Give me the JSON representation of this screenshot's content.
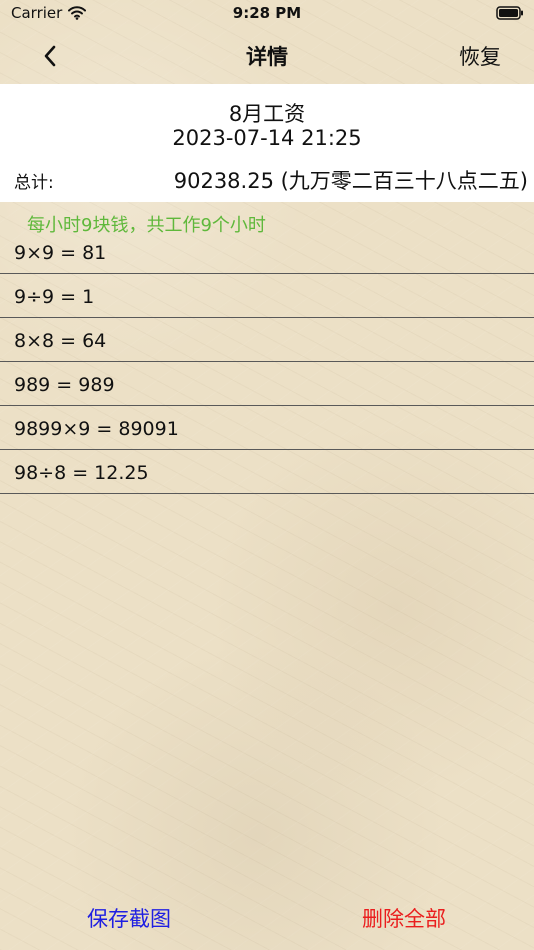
{
  "status_bar": {
    "carrier": "Carrier",
    "time": "9:28 PM"
  },
  "nav": {
    "title": "详情",
    "restore_label": "恢复"
  },
  "record": {
    "title": "8月工资",
    "date": "2023-07-14 21:25",
    "total_label": "总计:",
    "total_value": "90238.25 (九万零二百三十八点二五)"
  },
  "note": "每小时9块钱，共工作9个小时",
  "calculations": [
    "9×9 = 81",
    "9÷9 = 1",
    "8×8 = 64",
    "989 = 989",
    "9899×9 = 89091",
    "98÷8 = 12.25"
  ],
  "actions": {
    "save_screenshot": "保存截图",
    "delete_all": "删除全部"
  },
  "colors": {
    "background": "#ece0c6",
    "note_green": "#5fb83b",
    "save_blue": "#1f1fe2",
    "delete_red": "#ea1e1e"
  },
  "icons": {
    "wifi": "wifi-icon",
    "battery": "battery-icon",
    "back": "chevron-left-icon"
  }
}
